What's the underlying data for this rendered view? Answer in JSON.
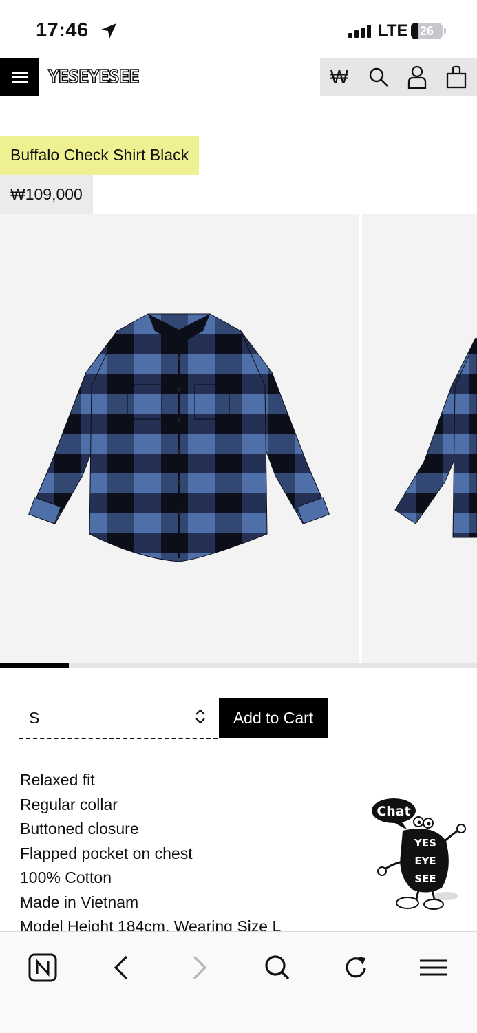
{
  "status_bar": {
    "time": "17:46",
    "network": "LTE",
    "battery": "26"
  },
  "header": {
    "logo": "YESEYESEE",
    "currency_symbol": "₩",
    "icons": [
      "menu-icon",
      "search-icon",
      "user-icon",
      "bag-icon"
    ]
  },
  "product": {
    "title": "Buffalo Check Shirt Black",
    "price": "₩109,000",
    "gallery": {
      "current_slide": 1,
      "progress_fraction": 0.145
    },
    "size": {
      "selected": "S"
    },
    "add_to_cart_label": "Add to Cart",
    "description": [
      "Relaxed fit",
      "Regular collar",
      "Buttoned closure",
      "Flapped pocket on chest",
      "100% Cotton",
      "Made in Vietnam",
      "Model Height 184cm, Wearing Size L"
    ]
  },
  "chat": {
    "label": "Chat",
    "mascot_text": "YES EYE SEE"
  },
  "browser_bar": {
    "icons": [
      "naver-icon",
      "back-icon",
      "forward-icon",
      "search-icon",
      "reload-icon",
      "menu-icon"
    ]
  },
  "colors": {
    "title_highlight": "#eff092",
    "price_background": "#ebebeb",
    "shirt_blue": "#4f6fa8",
    "shirt_black": "#101320",
    "tool_background": "#e6e6e6"
  }
}
